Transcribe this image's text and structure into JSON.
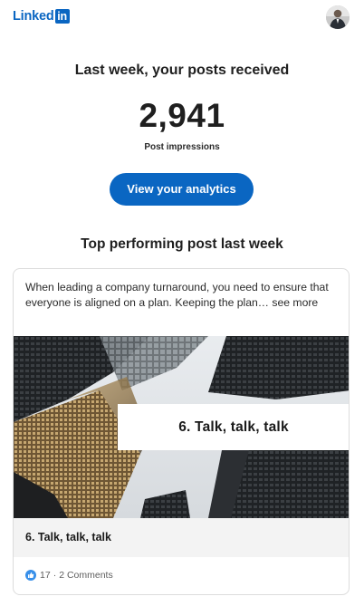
{
  "brand": {
    "logo_word": "Linked",
    "logo_box": "in",
    "color": "#0a66c2"
  },
  "header": {
    "avatar_icon": "profile-avatar"
  },
  "summary": {
    "headline": "Last week, your posts received",
    "impressions": "2,941",
    "impressions_label": "Post impressions",
    "cta_label": "View your analytics"
  },
  "top_post": {
    "section_title": "Top performing post last week",
    "text": "When leading a company turnaround, you need to ensure that everyone is aligned on a plan. Keeping the plan… see more",
    "image_overlay_title": "6. Talk, talk, talk",
    "caption": "6. Talk, talk, talk",
    "reactions": "17",
    "separator": "·",
    "comments": "2 Comments",
    "reaction_icon": "thumbs-up-icon"
  }
}
